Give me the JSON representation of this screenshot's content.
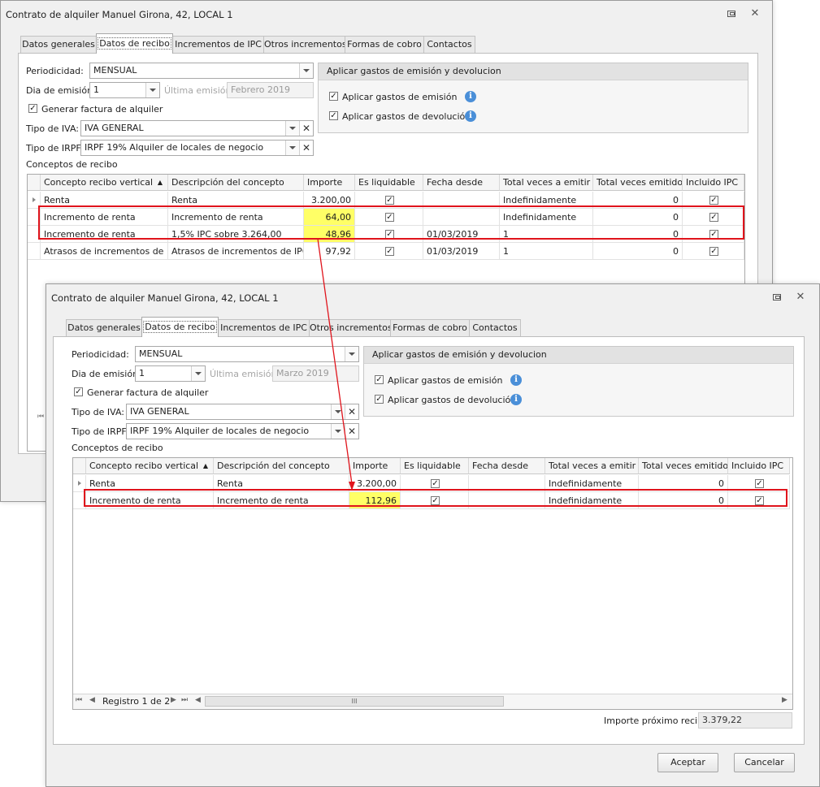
{
  "back_window": {
    "title": "Contrato de alquiler Manuel Girona, 42, LOCAL 1",
    "tabs": [
      "Datos generales",
      "Datos de recibo",
      "Incrementos de IPC",
      "Otros incrementos",
      "Formas de cobro",
      "Contactos"
    ],
    "active_tab": "Datos de recibo",
    "periodicidad_label": "Periodicidad:",
    "periodicidad_value": "MENSUAL",
    "dia_emision_label": "Dia de emisión:",
    "dia_emision_value": "1",
    "ultima_emision_label": "Última emisión:",
    "ultima_emision_value": "Febrero 2019",
    "generar_factura_label": "Generar factura de alquiler",
    "tipo_iva_label": "Tipo de IVA:",
    "tipo_iva_value": "IVA GENERAL",
    "tipo_irpf_label": "Tipo de IRPF:",
    "tipo_irpf_value": "IRPF 19% Alquiler de locales de negocio",
    "gastos_group_title": "Aplicar gastos de emisión y devolucion",
    "gastos_emision_label": "Aplicar gastos de emisión",
    "gastos_devolucion_label": "Aplicar gastos de devolución",
    "conceptos_label": "Conceptos de recibo",
    "columns": [
      "Concepto recibo vertical",
      "Descripción del concepto",
      "Importe",
      "Es liquidable",
      "Fecha desde",
      "Total veces a emitir",
      "Total veces emitido",
      "Incluido IPC"
    ],
    "rows": [
      {
        "concepto": "Renta",
        "descripcion": "Renta",
        "importe": "3.200,00",
        "fecha": "",
        "total_emitir": "Indefinidamente",
        "total_emitido": "0"
      },
      {
        "concepto": "Incremento de renta",
        "descripcion": "Incremento de renta",
        "importe": "64,00",
        "fecha": "",
        "total_emitir": "Indefinidamente",
        "total_emitido": "0"
      },
      {
        "concepto": "Incremento de renta",
        "descripcion": "1,5% IPC sobre 3.264,00",
        "importe": "48,96",
        "fecha": "01/03/2019",
        "total_emitir": "1",
        "total_emitido": "0"
      },
      {
        "concepto": "Atrasos de incrementos de IPC",
        "descripcion": "Atrasos de incrementos de IPC",
        "importe": "97,92",
        "fecha": "01/03/2019",
        "total_emitir": "1",
        "total_emitido": "0"
      }
    ]
  },
  "front_window": {
    "title": "Contrato de alquiler Manuel Girona, 42, LOCAL 1",
    "tabs": [
      "Datos generales",
      "Datos de recibo",
      "Incrementos de IPC",
      "Otros incrementos",
      "Formas de cobro",
      "Contactos"
    ],
    "active_tab": "Datos de recibo",
    "periodicidad_label": "Periodicidad:",
    "periodicidad_value": "MENSUAL",
    "dia_emision_label": "Dia de emisión:",
    "dia_emision_value": "1",
    "ultima_emision_label": "Última emisión:",
    "ultima_emision_value": "Marzo 2019",
    "generar_factura_label": "Generar factura de alquiler",
    "tipo_iva_label": "Tipo de IVA:",
    "tipo_iva_value": "IVA GENERAL",
    "tipo_irpf_label": "Tipo de IRPF:",
    "tipo_irpf_value": "IRPF 19% Alquiler de locales de negocio",
    "gastos_group_title": "Aplicar gastos de emisión y devolucion",
    "gastos_emision_label": "Aplicar gastos de emisión",
    "gastos_devolucion_label": "Aplicar gastos de devolución",
    "conceptos_label": "Conceptos de recibo",
    "columns": [
      "Concepto recibo vertical",
      "Descripción del concepto",
      "Importe",
      "Es liquidable",
      "Fecha desde",
      "Total veces a emitir",
      "Total veces emitido",
      "Incluido IPC"
    ],
    "rows": [
      {
        "concepto": "Renta",
        "descripcion": "Renta",
        "importe": "3.200,00",
        "fecha": "",
        "total_emitir": "Indefinidamente",
        "total_emitido": "0"
      },
      {
        "concepto": "Incremento de renta",
        "descripcion": "Incremento de renta",
        "importe": "112,96",
        "fecha": "",
        "total_emitir": "Indefinidamente",
        "total_emitido": "0"
      }
    ],
    "navigator_text": "Registro 1 de 2",
    "scroll_thumb_glyph": "III",
    "importe_proximo_label": "Importe próximo recibo",
    "importe_proximo_value": "3.379,22",
    "aceptar_label": "Aceptar",
    "cancelar_label": "Cancelar"
  },
  "colors": {
    "highlight": "#ffff66",
    "annotation_red": "#e0141c",
    "info_icon": "#4a8fd8"
  }
}
